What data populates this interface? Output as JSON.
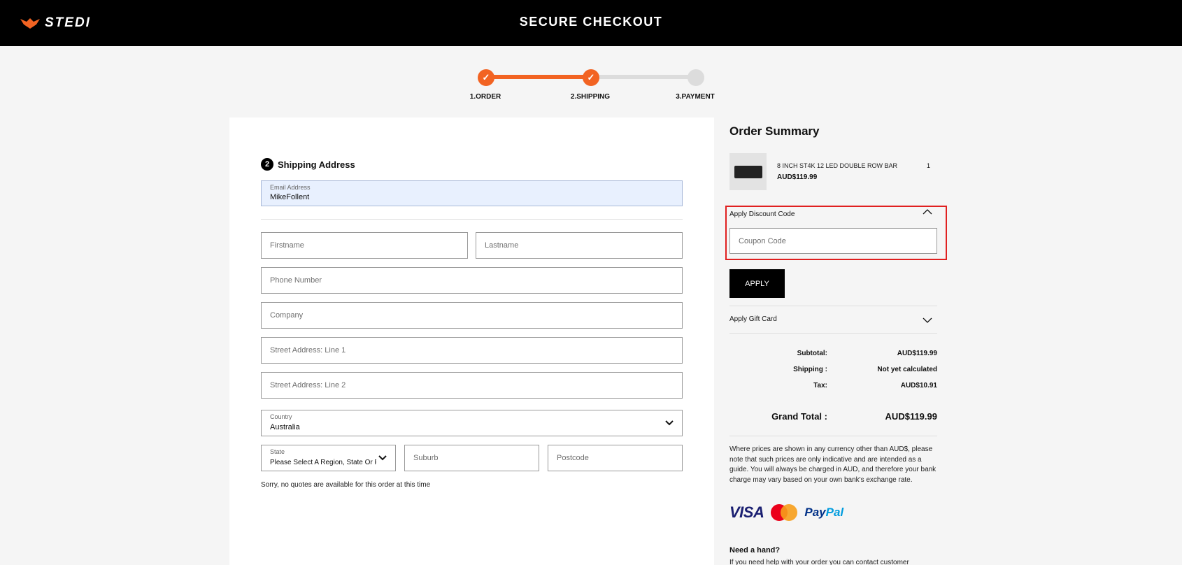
{
  "header": {
    "brand": "STEDI",
    "title": "SECURE CHECKOUT"
  },
  "progress": {
    "steps": [
      {
        "label": "1.ORDER",
        "status": "done"
      },
      {
        "label": "2.SHIPPING",
        "status": "done"
      },
      {
        "label": "3.PAYMENT",
        "status": "todo"
      }
    ],
    "check": "✓"
  },
  "shipping": {
    "step_number": "2",
    "heading": "Shipping Address",
    "email": {
      "label": "Email Address",
      "value": "MikeFollent"
    },
    "firstname": {
      "placeholder": "Firstname"
    },
    "lastname": {
      "placeholder": "Lastname"
    },
    "phone": {
      "placeholder": "Phone Number"
    },
    "company": {
      "placeholder": "Company"
    },
    "street1": {
      "placeholder": "Street Address: Line 1"
    },
    "street2": {
      "placeholder": "Street Address: Line 2"
    },
    "country": {
      "label": "Country",
      "value": "Australia"
    },
    "state": {
      "label": "State",
      "value": "Please Select A Region, State Or P"
    },
    "suburb": {
      "placeholder": "Suburb"
    },
    "postcode": {
      "placeholder": "Postcode"
    },
    "note": "Sorry, no quotes are available for this order at this time"
  },
  "summary": {
    "title": "Order Summary",
    "item": {
      "name": "8 INCH ST4K 12 LED DOUBLE ROW BAR",
      "price": "AUD$119.99",
      "qty": "1"
    },
    "discount": {
      "label": "Apply Discount Code",
      "placeholder": "Coupon Code",
      "apply": "APPLY"
    },
    "gift": {
      "label": "Apply Gift Card"
    },
    "totals": {
      "subtotal_label": "Subtotal:",
      "subtotal": "AUD$119.99",
      "shipping_label": "Shipping :",
      "shipping": "Not yet calculated",
      "tax_label": "Tax:",
      "tax": "AUD$10.91",
      "grand_label": "Grand Total :",
      "grand": "AUD$119.99"
    },
    "disclaimer": "Where prices are shown in any currency other than AUD$, please note that such prices are only indicative and are intended as a guide. You will always be charged in AUD, and therefore your bank charge may vary based on your own bank's exchange rate.",
    "payments": {
      "visa": "VISA",
      "mastercard": "MasterCard",
      "paypal_a": "Pay",
      "paypal_b": "Pal"
    },
    "help": {
      "heading": "Need a hand?",
      "text": "If you need help with your order you can contact customer"
    }
  },
  "colors": {
    "accent": "#f26322",
    "highlight": "#e02020",
    "header_bg": "#000000"
  },
  "icons": {
    "chevron_down": "chevron-down-icon",
    "chevron_up": "chevron-up-icon",
    "check": "check-icon",
    "logo": "stedi-logo-icon"
  }
}
